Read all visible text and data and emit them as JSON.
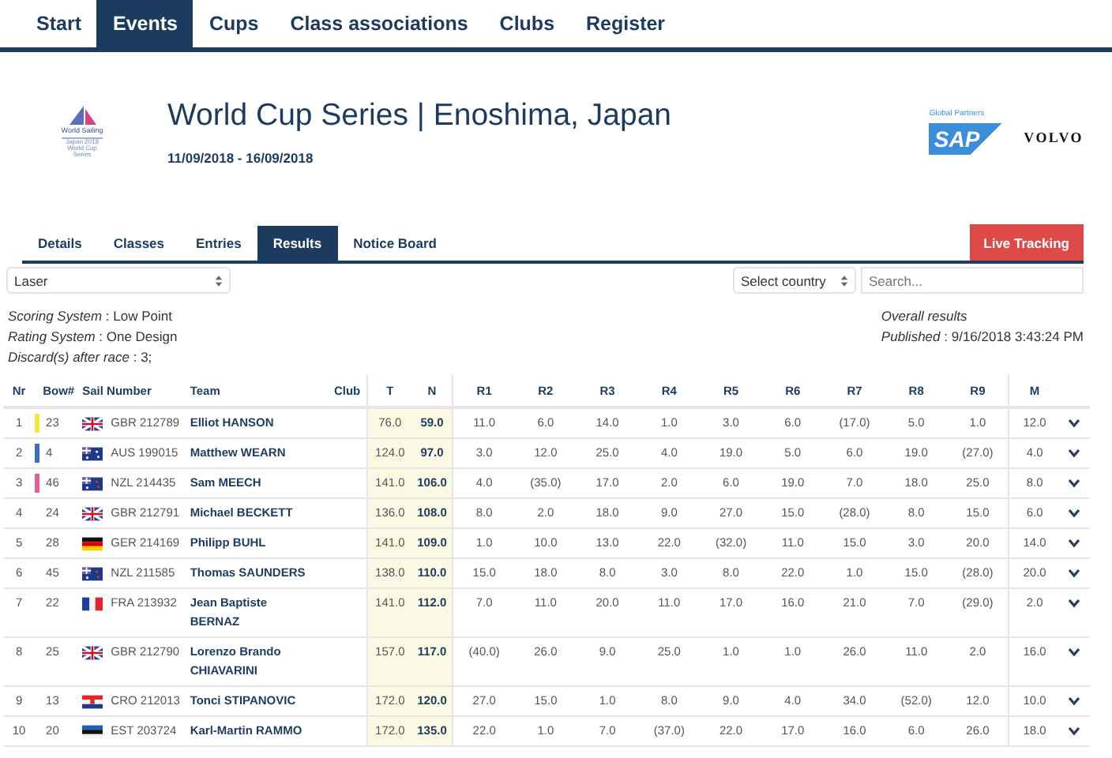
{
  "nav": [
    {
      "label": "Start",
      "selected": false
    },
    {
      "label": "Events",
      "selected": true
    },
    {
      "label": "Cups",
      "selected": false
    },
    {
      "label": "Class associations",
      "selected": false
    },
    {
      "label": "Clubs",
      "selected": false
    },
    {
      "label": "Register",
      "selected": false
    }
  ],
  "event": {
    "logo_lines": [
      "World Sailing",
      "Japan 2018",
      "World Cup",
      "Series"
    ],
    "title": "World Cup Series | Enoshima, Japan",
    "dates": "11/09/2018 - 16/09/2018",
    "partners_label": "Global Partners",
    "partners": [
      "SAP",
      "VOLVO"
    ]
  },
  "tabs": [
    {
      "label": "Details",
      "selected": false
    },
    {
      "label": "Classes",
      "selected": false
    },
    {
      "label": "Entries",
      "selected": false
    },
    {
      "label": "Results",
      "selected": true
    },
    {
      "label": "Notice Board",
      "selected": false
    }
  ],
  "live_button": "Live Tracking",
  "filters": {
    "class_select": "Laser",
    "country_select": "Select country",
    "search": {
      "placeholder": "Search..."
    }
  },
  "info": [
    "*Scoring System* : Low Point",
    "*Rating System* : One Design",
    "*Discard(s) after race* : 3;"
  ],
  "overall": {
    "title": "Overall results",
    "published": "*Published* : 9/16/2018 3:43:24 PM"
  },
  "table": {
    "columns": [
      "Nr",
      "Bow#",
      "Sail Number",
      "Team",
      "Club",
      "T",
      "N",
      "R1",
      "R2",
      "R3",
      "R4",
      "R5",
      "R6",
      "R7",
      "R8",
      "R9",
      "M"
    ],
    "rows": [
      {
        "nr": "1",
        "bow": "23",
        "color": "#f2ea3a",
        "kind": "gb",
        "sail": "GBR 212789",
        "team": "Elliot HANSON",
        "t": "76.0",
        "n": "59.0",
        "races": [
          "11.0",
          "6.0",
          "14.0",
          "1.0",
          "3.0",
          "6.0",
          "(17.0)",
          "5.0",
          "1.0"
        ],
        "m": "12.0"
      },
      {
        "nr": "2",
        "bow": "4",
        "color": "#3a6fc4",
        "kind": "au",
        "sail": "AUS 199015",
        "team": "Matthew WEARN",
        "t": "124.0",
        "n": "97.0",
        "races": [
          "3.0",
          "12.0",
          "25.0",
          "4.0",
          "19.0",
          "5.0",
          "6.0",
          "19.0",
          "(27.0)"
        ],
        "m": "4.0"
      },
      {
        "nr": "3",
        "bow": "46",
        "color": "#e0609a",
        "kind": "nz",
        "sail": "NZL 214435",
        "team": "Sam MEECH",
        "t": "141.0",
        "n": "106.0",
        "races": [
          "4.0",
          "(35.0)",
          "17.0",
          "2.0",
          "6.0",
          "19.0",
          "7.0",
          "18.0",
          "25.0"
        ],
        "m": "8.0"
      },
      {
        "nr": "4",
        "bow": "24",
        "kind": "gb",
        "sail": "GBR 212791",
        "team": "Michael BECKETT",
        "t": "136.0",
        "n": "108.0",
        "races": [
          "8.0",
          "2.0",
          "18.0",
          "9.0",
          "27.0",
          "15.0",
          "(28.0)",
          "8.0",
          "15.0"
        ],
        "m": "6.0"
      },
      {
        "nr": "5",
        "bow": "28",
        "kind": "de",
        "sail": "GER 214169",
        "team": "Philipp BUHL",
        "t": "141.0",
        "n": "109.0",
        "races": [
          "1.0",
          "10.0",
          "13.0",
          "22.0",
          "(32.0)",
          "11.0",
          "15.0",
          "3.0",
          "20.0"
        ],
        "m": "14.0"
      },
      {
        "nr": "6",
        "bow": "45",
        "kind": "nz",
        "sail": "NZL 211585",
        "team": "Thomas SAUNDERS",
        "t": "138.0",
        "n": "110.0",
        "races": [
          "15.0",
          "18.0",
          "8.0",
          "3.0",
          "8.0",
          "22.0",
          "1.0",
          "15.0",
          "(28.0)"
        ],
        "m": "20.0"
      },
      {
        "nr": "7",
        "bow": "22",
        "kind": "fr",
        "sail": "FRA 213932",
        "team": "Jean Baptiste BERNAZ",
        "t": "141.0",
        "n": "112.0",
        "races": [
          "7.0",
          "11.0",
          "20.0",
          "11.0",
          "17.0",
          "16.0",
          "21.0",
          "7.0",
          "(29.0)"
        ],
        "m": "2.0"
      },
      {
        "nr": "8",
        "bow": "25",
        "kind": "gb",
        "sail": "GBR 212790",
        "team": "Lorenzo Brando CHIAVARINI",
        "t": "157.0",
        "n": "117.0",
        "races": [
          "(40.0)",
          "26.0",
          "9.0",
          "25.0",
          "1.0",
          "1.0",
          "26.0",
          "11.0",
          "2.0"
        ],
        "m": "16.0"
      },
      {
        "nr": "9",
        "bow": "13",
        "kind": "hr",
        "sail": "CRO 212013",
        "team": "Tonci STIPANOVIC",
        "t": "172.0",
        "n": "120.0",
        "races": [
          "27.0",
          "15.0",
          "1.0",
          "8.0",
          "9.0",
          "4.0",
          "34.0",
          "(52.0)",
          "12.0"
        ],
        "m": "10.0"
      },
      {
        "nr": "10",
        "bow": "20",
        "kind": "ee",
        "sail": "EST 203724",
        "team": "Karl-Martin RAMMO",
        "t": "172.0",
        "n": "135.0",
        "races": [
          "22.0",
          "1.0",
          "7.0",
          "(37.0)",
          "22.0",
          "17.0",
          "16.0",
          "6.0",
          "26.0"
        ],
        "m": "18.0"
      }
    ]
  }
}
